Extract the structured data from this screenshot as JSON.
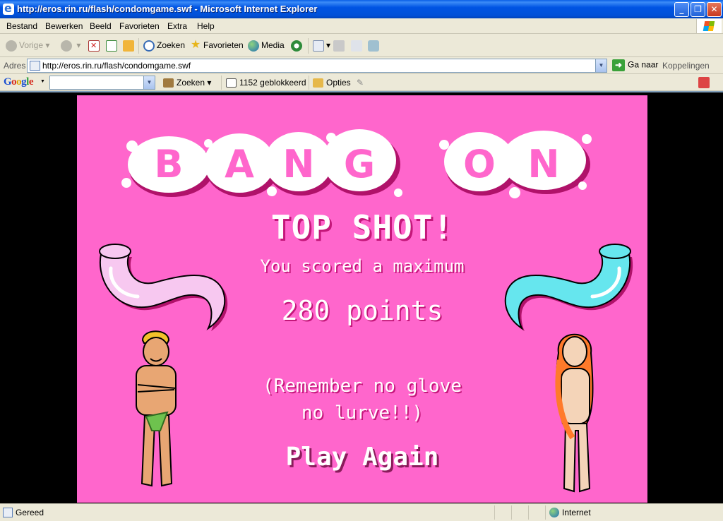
{
  "window": {
    "title": "http://eros.rin.ru/flash/condomgame.swf - Microsoft Internet Explorer",
    "min_label": "_",
    "max_label": "❐",
    "close_label": "✕"
  },
  "menu": {
    "items": [
      "Bestand",
      "Bewerken",
      "Beeld",
      "Favorieten",
      "Extra",
      "Help"
    ]
  },
  "toolbar": {
    "back_label": "Vorige",
    "search_label": "Zoeken",
    "favorites_label": "Favorieten",
    "media_label": "Media"
  },
  "address": {
    "label": "Adres",
    "url": "http://eros.rin.ru/flash/condomgame.swf",
    "go_label": "Ga naar",
    "links_label": "Koppelingen"
  },
  "google_toolbar": {
    "logo": "Google",
    "search_label": "Zoeken",
    "popups_label": "1152 geblokkeerd",
    "options_label": "Opties"
  },
  "game": {
    "logo_text": "BANG ON",
    "headline": "TOP SHOT!",
    "subtitle": "You scored a maximum",
    "points": "280 points",
    "reminder_line1": "(Remember no glove",
    "reminder_line2": "no lurve!!)",
    "play_again": "Play Again",
    "colors": {
      "background": "#ff66cc",
      "shadow": "#c4177a",
      "left_tube": "#f7c8f0",
      "right_tube": "#66e6ee"
    }
  },
  "status": {
    "text": "Gereed",
    "zone": "Internet"
  }
}
